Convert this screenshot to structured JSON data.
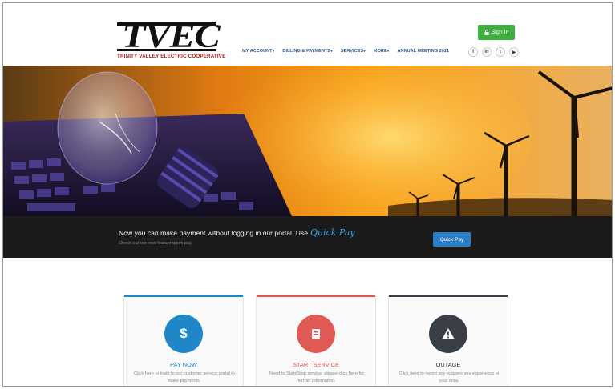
{
  "brand": {
    "logo_text": "TVEC",
    "logo_subtitle": "TRINITY VALLEY ELECTRIC COOPERATIVE"
  },
  "header": {
    "signin_label": "Sign In",
    "nav": [
      {
        "label": "MY ACCOUNT▾"
      },
      {
        "label": "BILLING & PAYMENTS▾"
      },
      {
        "label": "SERVICES▾"
      },
      {
        "label": "MORE▾"
      },
      {
        "label": "ANNUAL MEETING 2021"
      }
    ],
    "social": [
      {
        "glyph": "f",
        "icon": "facebook-icon"
      },
      {
        "glyph": "in",
        "icon": "linkedin-icon"
      },
      {
        "glyph": "t",
        "icon": "twitter-icon"
      },
      {
        "glyph": "▶",
        "icon": "youtube-icon"
      }
    ]
  },
  "banner": {
    "text": "Now you can make payment without logging in our portal. Use",
    "highlight": "Quick Pay",
    "subtext": "Check out our new feature quick pay.",
    "button_label": "Quick Pay"
  },
  "cards": [
    {
      "title": "PAY NOW",
      "desc": "Click here to login to our customer service portal to make payments.",
      "glyph": "$",
      "icon": "dollar-icon",
      "color": "#1f86c8",
      "title_color": "#1f86c8"
    },
    {
      "title": "START SERVICE",
      "desc": "Need to Start/Stop service, please click here for further information.",
      "glyph": "▆",
      "icon": "book-icon",
      "color": "#e05a55",
      "title_color": "#d9534f"
    },
    {
      "title": "OUTAGE",
      "desc": "Click here to report any outages you experience in your area.",
      "glyph": "!",
      "icon": "warning-icon",
      "color": "#3a3f47",
      "title_color": "#333333"
    }
  ],
  "colors": {
    "signin_green": "#3fae3f",
    "banner_bg": "#1b1b1b",
    "quickpay_blue": "#2a7ec6",
    "nav_blue": "#2a5d9a"
  }
}
